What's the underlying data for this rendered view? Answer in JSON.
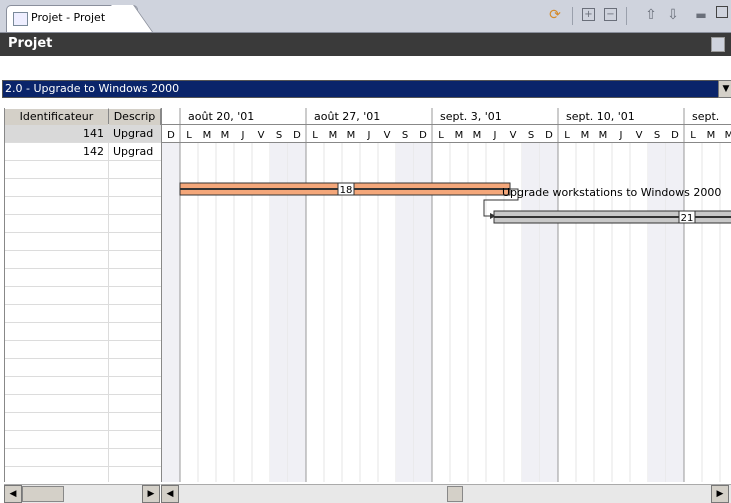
{
  "tab": {
    "label": "Projet - Projet"
  },
  "header": {
    "title": "Projet"
  },
  "project_select": {
    "value": "2.0 - Upgrade to Windows 2000"
  },
  "table": {
    "columns": [
      "Identificateur",
      "Descrip"
    ],
    "rows": [
      {
        "id": "141",
        "desc": "Upgrad"
      },
      {
        "id": "142",
        "desc": "Upgrad"
      }
    ]
  },
  "gantt": {
    "weeks": [
      "août 20, '01",
      "août 27, '01",
      "sept. 3, '01",
      "sept. 10, '01",
      "sept."
    ],
    "first_day": "D",
    "days": [
      "L",
      "M",
      "M",
      "J",
      "V",
      "S",
      "D"
    ],
    "tasks": [
      {
        "id": "18",
        "label": "Upgrade workstations to Windows 2000",
        "color": "#f4a77a"
      },
      {
        "id": "21",
        "label": "",
        "color": "#c8c8c8"
      }
    ]
  },
  "icons": [
    "sync-icon",
    "expand-all-icon",
    "collapse-all-icon",
    "arrow-up-icon",
    "arrow-down-icon",
    "minimize-icon",
    "maximize-icon"
  ]
}
